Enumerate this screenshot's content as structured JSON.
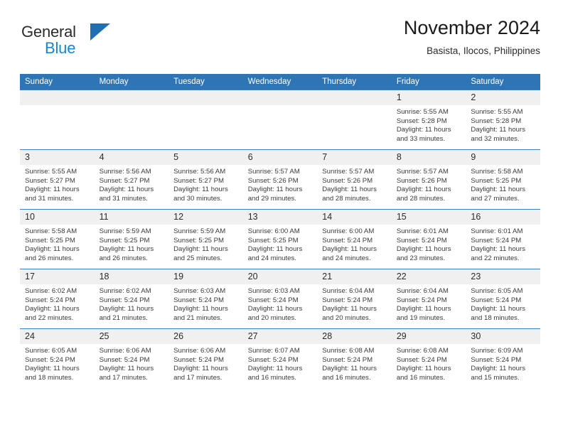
{
  "brand": {
    "name_part1": "General",
    "name_part2": "Blue",
    "triangle_icon": "triangle-icon",
    "accent_color": "#1f6fb2",
    "blue_text_color": "#1886d4"
  },
  "header": {
    "title": "November 2024",
    "subtitle": "Basista, Ilocos, Philippines"
  },
  "theme": {
    "header_blue": "#2e75b6",
    "daynum_band": "#f0f0f0",
    "text": "#3a3a3a"
  },
  "weekday_headers": [
    "Sunday",
    "Monday",
    "Tuesday",
    "Wednesday",
    "Thursday",
    "Friday",
    "Saturday"
  ],
  "weeks": [
    [
      {
        "day": "",
        "sunrise": "",
        "sunset": "",
        "daylight_line1": "",
        "daylight_line2": "",
        "empty": true
      },
      {
        "day": "",
        "sunrise": "",
        "sunset": "",
        "daylight_line1": "",
        "daylight_line2": "",
        "empty": true
      },
      {
        "day": "",
        "sunrise": "",
        "sunset": "",
        "daylight_line1": "",
        "daylight_line2": "",
        "empty": true
      },
      {
        "day": "",
        "sunrise": "",
        "sunset": "",
        "daylight_line1": "",
        "daylight_line2": "",
        "empty": true
      },
      {
        "day": "",
        "sunrise": "",
        "sunset": "",
        "daylight_line1": "",
        "daylight_line2": "",
        "empty": true
      },
      {
        "day": "1",
        "sunrise": "Sunrise: 5:55 AM",
        "sunset": "Sunset: 5:28 PM",
        "daylight_line1": "Daylight: 11 hours",
        "daylight_line2": "and 33 minutes."
      },
      {
        "day": "2",
        "sunrise": "Sunrise: 5:55 AM",
        "sunset": "Sunset: 5:28 PM",
        "daylight_line1": "Daylight: 11 hours",
        "daylight_line2": "and 32 minutes."
      }
    ],
    [
      {
        "day": "3",
        "sunrise": "Sunrise: 5:55 AM",
        "sunset": "Sunset: 5:27 PM",
        "daylight_line1": "Daylight: 11 hours",
        "daylight_line2": "and 31 minutes."
      },
      {
        "day": "4",
        "sunrise": "Sunrise: 5:56 AM",
        "sunset": "Sunset: 5:27 PM",
        "daylight_line1": "Daylight: 11 hours",
        "daylight_line2": "and 31 minutes."
      },
      {
        "day": "5",
        "sunrise": "Sunrise: 5:56 AM",
        "sunset": "Sunset: 5:27 PM",
        "daylight_line1": "Daylight: 11 hours",
        "daylight_line2": "and 30 minutes."
      },
      {
        "day": "6",
        "sunrise": "Sunrise: 5:57 AM",
        "sunset": "Sunset: 5:26 PM",
        "daylight_line1": "Daylight: 11 hours",
        "daylight_line2": "and 29 minutes."
      },
      {
        "day": "7",
        "sunrise": "Sunrise: 5:57 AM",
        "sunset": "Sunset: 5:26 PM",
        "daylight_line1": "Daylight: 11 hours",
        "daylight_line2": "and 28 minutes."
      },
      {
        "day": "8",
        "sunrise": "Sunrise: 5:57 AM",
        "sunset": "Sunset: 5:26 PM",
        "daylight_line1": "Daylight: 11 hours",
        "daylight_line2": "and 28 minutes."
      },
      {
        "day": "9",
        "sunrise": "Sunrise: 5:58 AM",
        "sunset": "Sunset: 5:25 PM",
        "daylight_line1": "Daylight: 11 hours",
        "daylight_line2": "and 27 minutes."
      }
    ],
    [
      {
        "day": "10",
        "sunrise": "Sunrise: 5:58 AM",
        "sunset": "Sunset: 5:25 PM",
        "daylight_line1": "Daylight: 11 hours",
        "daylight_line2": "and 26 minutes."
      },
      {
        "day": "11",
        "sunrise": "Sunrise: 5:59 AM",
        "sunset": "Sunset: 5:25 PM",
        "daylight_line1": "Daylight: 11 hours",
        "daylight_line2": "and 26 minutes."
      },
      {
        "day": "12",
        "sunrise": "Sunrise: 5:59 AM",
        "sunset": "Sunset: 5:25 PM",
        "daylight_line1": "Daylight: 11 hours",
        "daylight_line2": "and 25 minutes."
      },
      {
        "day": "13",
        "sunrise": "Sunrise: 6:00 AM",
        "sunset": "Sunset: 5:25 PM",
        "daylight_line1": "Daylight: 11 hours",
        "daylight_line2": "and 24 minutes."
      },
      {
        "day": "14",
        "sunrise": "Sunrise: 6:00 AM",
        "sunset": "Sunset: 5:24 PM",
        "daylight_line1": "Daylight: 11 hours",
        "daylight_line2": "and 24 minutes."
      },
      {
        "day": "15",
        "sunrise": "Sunrise: 6:01 AM",
        "sunset": "Sunset: 5:24 PM",
        "daylight_line1": "Daylight: 11 hours",
        "daylight_line2": "and 23 minutes."
      },
      {
        "day": "16",
        "sunrise": "Sunrise: 6:01 AM",
        "sunset": "Sunset: 5:24 PM",
        "daylight_line1": "Daylight: 11 hours",
        "daylight_line2": "and 22 minutes."
      }
    ],
    [
      {
        "day": "17",
        "sunrise": "Sunrise: 6:02 AM",
        "sunset": "Sunset: 5:24 PM",
        "daylight_line1": "Daylight: 11 hours",
        "daylight_line2": "and 22 minutes."
      },
      {
        "day": "18",
        "sunrise": "Sunrise: 6:02 AM",
        "sunset": "Sunset: 5:24 PM",
        "daylight_line1": "Daylight: 11 hours",
        "daylight_line2": "and 21 minutes."
      },
      {
        "day": "19",
        "sunrise": "Sunrise: 6:03 AM",
        "sunset": "Sunset: 5:24 PM",
        "daylight_line1": "Daylight: 11 hours",
        "daylight_line2": "and 21 minutes."
      },
      {
        "day": "20",
        "sunrise": "Sunrise: 6:03 AM",
        "sunset": "Sunset: 5:24 PM",
        "daylight_line1": "Daylight: 11 hours",
        "daylight_line2": "and 20 minutes."
      },
      {
        "day": "21",
        "sunrise": "Sunrise: 6:04 AM",
        "sunset": "Sunset: 5:24 PM",
        "daylight_line1": "Daylight: 11 hours",
        "daylight_line2": "and 20 minutes."
      },
      {
        "day": "22",
        "sunrise": "Sunrise: 6:04 AM",
        "sunset": "Sunset: 5:24 PM",
        "daylight_line1": "Daylight: 11 hours",
        "daylight_line2": "and 19 minutes."
      },
      {
        "day": "23",
        "sunrise": "Sunrise: 6:05 AM",
        "sunset": "Sunset: 5:24 PM",
        "daylight_line1": "Daylight: 11 hours",
        "daylight_line2": "and 18 minutes."
      }
    ],
    [
      {
        "day": "24",
        "sunrise": "Sunrise: 6:05 AM",
        "sunset": "Sunset: 5:24 PM",
        "daylight_line1": "Daylight: 11 hours",
        "daylight_line2": "and 18 minutes."
      },
      {
        "day": "25",
        "sunrise": "Sunrise: 6:06 AM",
        "sunset": "Sunset: 5:24 PM",
        "daylight_line1": "Daylight: 11 hours",
        "daylight_line2": "and 17 minutes."
      },
      {
        "day": "26",
        "sunrise": "Sunrise: 6:06 AM",
        "sunset": "Sunset: 5:24 PM",
        "daylight_line1": "Daylight: 11 hours",
        "daylight_line2": "and 17 minutes."
      },
      {
        "day": "27",
        "sunrise": "Sunrise: 6:07 AM",
        "sunset": "Sunset: 5:24 PM",
        "daylight_line1": "Daylight: 11 hours",
        "daylight_line2": "and 16 minutes."
      },
      {
        "day": "28",
        "sunrise": "Sunrise: 6:08 AM",
        "sunset": "Sunset: 5:24 PM",
        "daylight_line1": "Daylight: 11 hours",
        "daylight_line2": "and 16 minutes."
      },
      {
        "day": "29",
        "sunrise": "Sunrise: 6:08 AM",
        "sunset": "Sunset: 5:24 PM",
        "daylight_line1": "Daylight: 11 hours",
        "daylight_line2": "and 16 minutes."
      },
      {
        "day": "30",
        "sunrise": "Sunrise: 6:09 AM",
        "sunset": "Sunset: 5:24 PM",
        "daylight_line1": "Daylight: 11 hours",
        "daylight_line2": "and 15 minutes."
      }
    ]
  ]
}
